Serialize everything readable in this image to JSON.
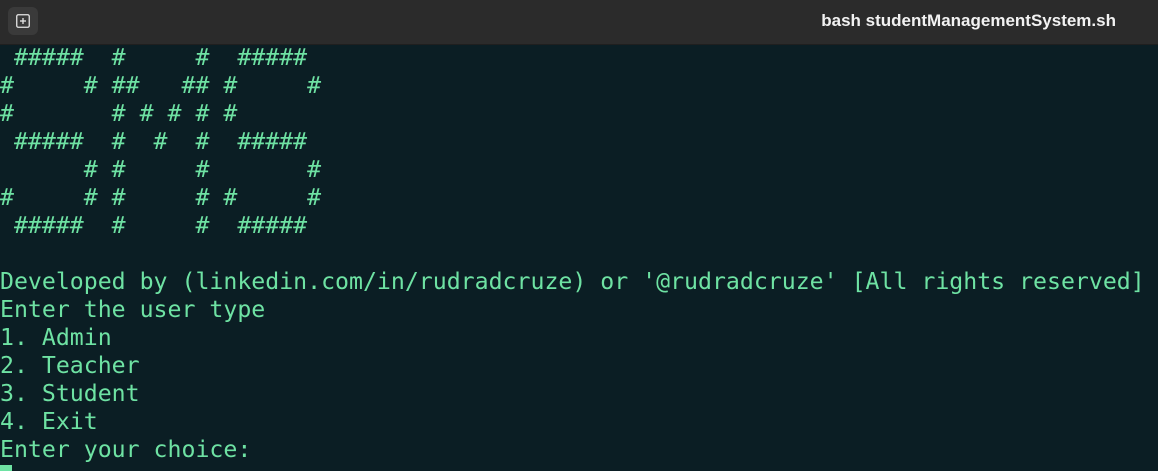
{
  "window": {
    "title": "bash studentManagementSystem.sh"
  },
  "terminal": {
    "banner": [
      " #####  #     #  #####",
      "#     # ##   ## #     #",
      "#       # # # # #",
      " #####  #  #  #  #####",
      "      # #     #       #",
      "#     # #     # #     #",
      " #####  #     #  #####"
    ],
    "blank": "",
    "credit": "Developed by (linkedin.com/in/rudradcruze) or '@rudradcruze' [All rights reserved]",
    "prompt_heading": "Enter the user type",
    "options": [
      "1. Admin",
      "2. Teacher",
      "3. Student",
      "4. Exit"
    ],
    "choice_prompt": "Enter your choice:"
  },
  "colors": {
    "background": "#0b1e24",
    "text": "#6ee2a3",
    "titlebar": "#2b2b2b"
  },
  "icons": {
    "new_tab": "new-tab-icon"
  }
}
